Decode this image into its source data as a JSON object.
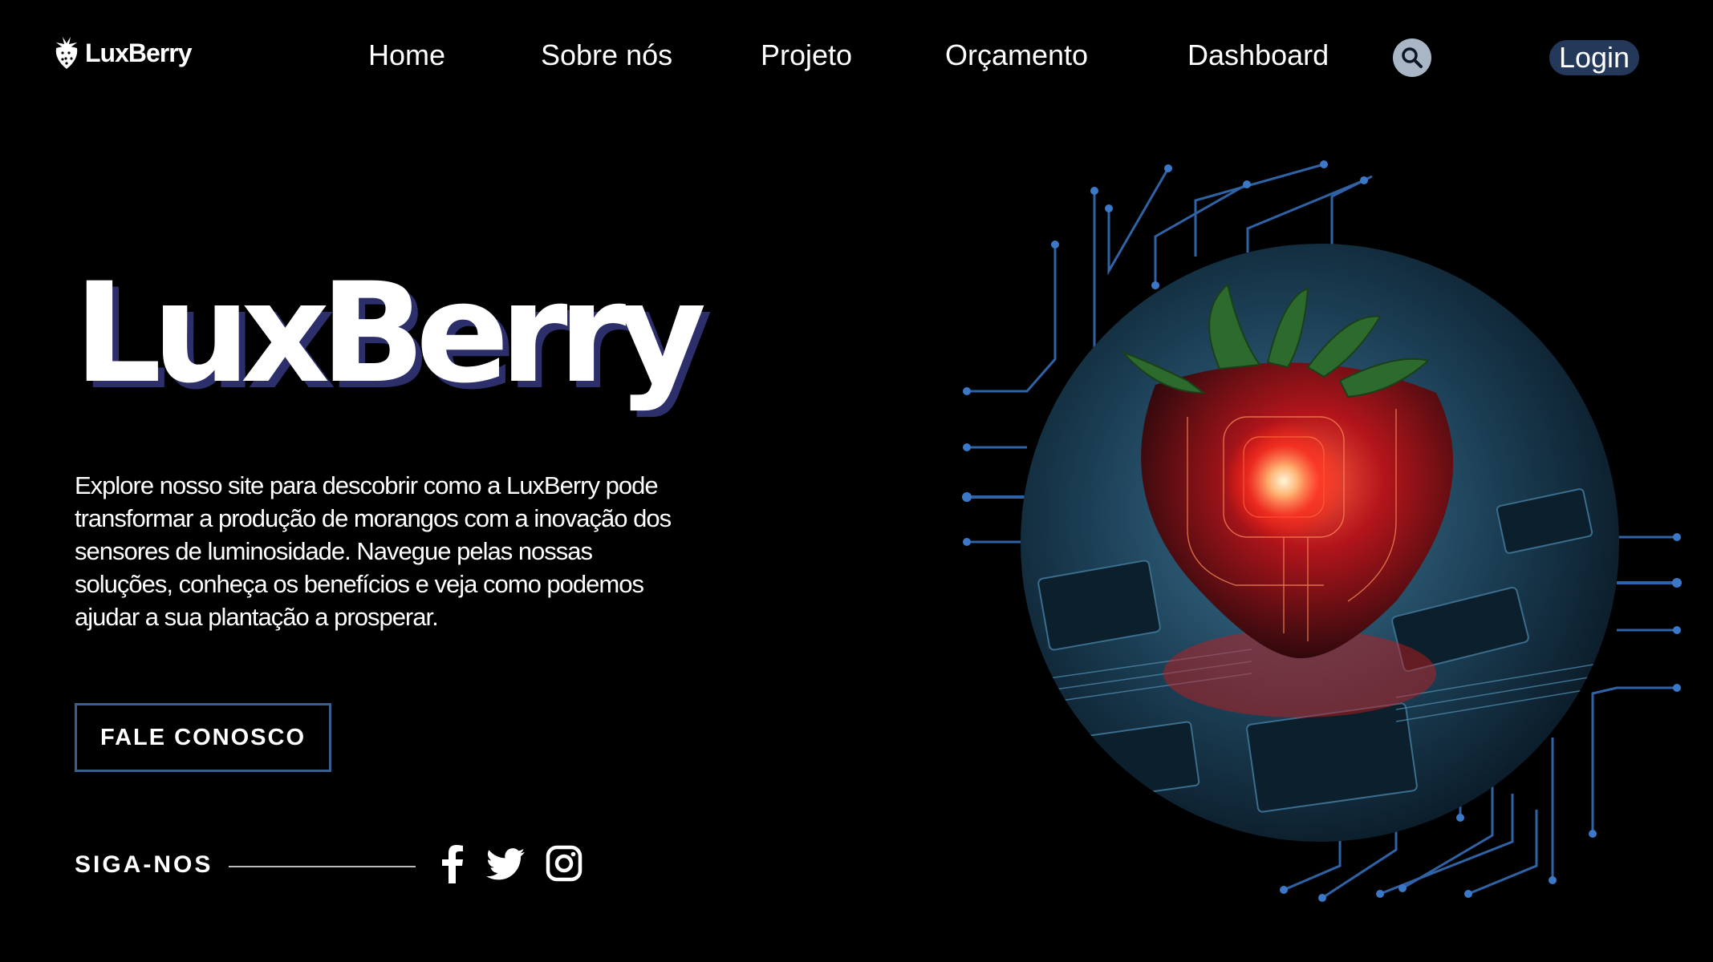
{
  "nav": {
    "logo_text": "LuxBerry",
    "links": [
      "Home",
      "Sobre nós",
      "Projeto",
      "Orçamento",
      "Dashboard"
    ],
    "login_label": "Login"
  },
  "hero": {
    "title": "LuxBerry",
    "description": "Explore nosso site para descobrir como a LuxBerry pode transformar a produção de morangos com a inovação dos sensores de luminosidade. Navegue pelas nossas soluções, conheça os benefícios e veja como podemos ajudar a sua plantação a prosperar.",
    "cta_label": "FALE CONOSCO"
  },
  "social": {
    "label": "SIGA-NOS",
    "icons": [
      "facebook-icon",
      "twitter-icon",
      "instagram-icon"
    ]
  },
  "colors": {
    "background": "#000000",
    "accent": "#3a5f8f",
    "login_bg": "#24395a",
    "title_shadow": "#2d2f6b",
    "search_bg": "#a9b6c6"
  }
}
